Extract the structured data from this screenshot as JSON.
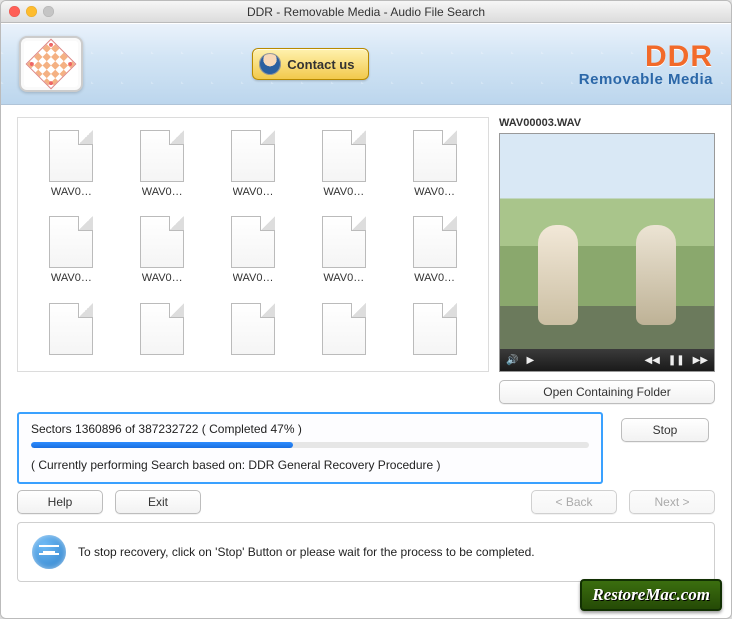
{
  "window": {
    "title": "DDR - Removable Media - Audio File Search"
  },
  "header": {
    "contact_label": "Contact us",
    "brand_title": "DDR",
    "brand_subtitle": "Removable Media"
  },
  "files": {
    "items": [
      {
        "label": "WAV0…"
      },
      {
        "label": "WAV0…"
      },
      {
        "label": "WAV0…"
      },
      {
        "label": "WAV0…"
      },
      {
        "label": "WAV0…"
      },
      {
        "label": "WAV0…"
      },
      {
        "label": "WAV0…"
      },
      {
        "label": "WAV0…"
      },
      {
        "label": "WAV0…"
      },
      {
        "label": "WAV0…"
      },
      {
        "label": ""
      },
      {
        "label": ""
      },
      {
        "label": ""
      },
      {
        "label": ""
      },
      {
        "label": ""
      }
    ]
  },
  "preview": {
    "filename": "WAV00003.WAV",
    "open_folder_label": "Open Containing Folder"
  },
  "progress": {
    "sectors_current": "1360896",
    "sectors_total": "387232722",
    "completed_percent": 47,
    "text": "Sectors 1360896 of 387232722    ( Completed  47% )",
    "procedure_text": "( Currently performing Search based on: DDR General Recovery Procedure )",
    "stop_label": "Stop"
  },
  "nav": {
    "help_label": "Help",
    "exit_label": "Exit",
    "back_label": "< Back",
    "next_label": "Next >"
  },
  "hint": {
    "text": "To stop recovery, click on 'Stop' Button or please wait for the process to be completed."
  },
  "watermark": {
    "text": "RestoreMac.com"
  }
}
